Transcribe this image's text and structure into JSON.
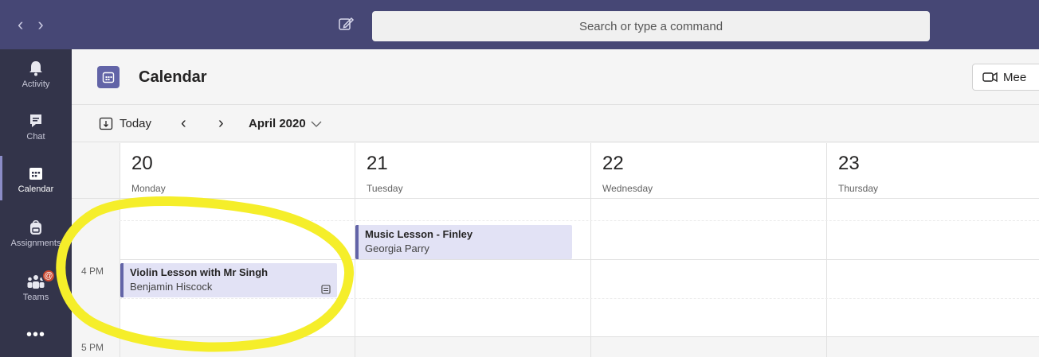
{
  "topbar": {
    "back_glyph": "‹",
    "forward_glyph": "›",
    "compose_icon": "compose-icon",
    "search_placeholder": "Search or type a command"
  },
  "rail": {
    "items": [
      {
        "label": "Activity",
        "icon": "bell-icon"
      },
      {
        "label": "Chat",
        "icon": "chat-icon"
      },
      {
        "label": "Calendar",
        "icon": "calendar-icon",
        "active": true
      },
      {
        "label": "Assignments",
        "icon": "backpack-icon"
      },
      {
        "label": "Teams",
        "icon": "teams-icon",
        "badge": "@"
      }
    ],
    "more_glyph": "•••"
  },
  "header": {
    "title": "Calendar",
    "meet_label": "Mee"
  },
  "toolbar": {
    "today_label": "Today",
    "prev_glyph": "‹",
    "next_glyph": "›",
    "month_label": "April 2020"
  },
  "days": [
    {
      "num": "20",
      "name": "Monday"
    },
    {
      "num": "21",
      "name": "Tuesday"
    },
    {
      "num": "22",
      "name": "Wednesday"
    },
    {
      "num": "23",
      "name": "Thursday"
    }
  ],
  "times": [
    "4 PM",
    "5 PM"
  ],
  "events": [
    {
      "title": "Music Lesson - Finley",
      "organizer": "Georgia Parry",
      "day": "21"
    },
    {
      "title": "Violin Lesson with Mr Singh",
      "organizer": "Benjamin Hiscock",
      "day": "20"
    }
  ],
  "colors": {
    "accent": "#6264a7",
    "topbar": "#464775",
    "rail": "#33344a",
    "event_bg": "#e2e2f5",
    "annotation": "#f5ee2a",
    "badge": "#cc4a31"
  }
}
